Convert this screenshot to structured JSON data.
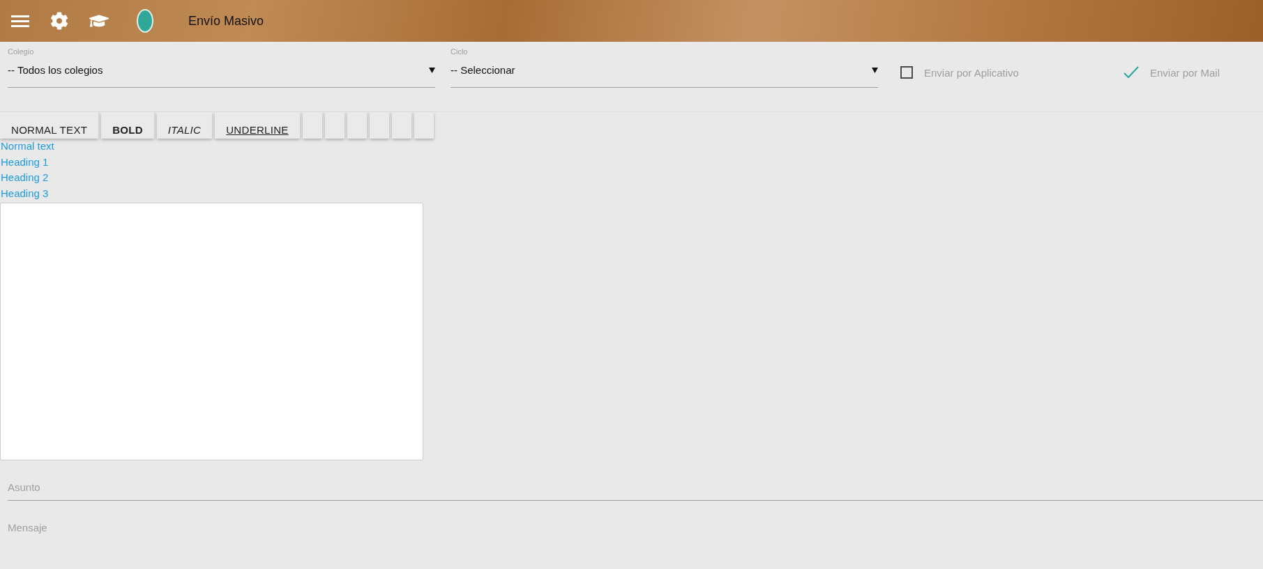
{
  "header": {
    "title": "Envío Masivo"
  },
  "filters": [
    {
      "label": "Colegio",
      "value": "-- Todos los colegios"
    },
    {
      "label": "Ciclo",
      "value": "-- Seleccionar"
    }
  ],
  "options": [
    {
      "label": "Enviar por Aplicativo",
      "checked": false
    },
    {
      "label": "Enviar por Mail",
      "checked": true
    }
  ],
  "toolbar": [
    {
      "label": "NORMAL TEXT",
      "kind": "normal"
    },
    {
      "label": "BOLD",
      "kind": "bold"
    },
    {
      "label": "ITALIC",
      "kind": "italic"
    },
    {
      "label": "UNDERLINE",
      "kind": "underline"
    },
    {
      "kind": "blank"
    },
    {
      "kind": "blank"
    },
    {
      "kind": "blank"
    },
    {
      "kind": "blank"
    },
    {
      "kind": "blank"
    },
    {
      "kind": "blank"
    }
  ],
  "format_menu": [
    "Normal text",
    "Heading 1",
    "Heading 2",
    "Heading 3"
  ],
  "fields": [
    {
      "placeholder": "Asunto"
    },
    {
      "placeholder": "Mensaje"
    }
  ]
}
